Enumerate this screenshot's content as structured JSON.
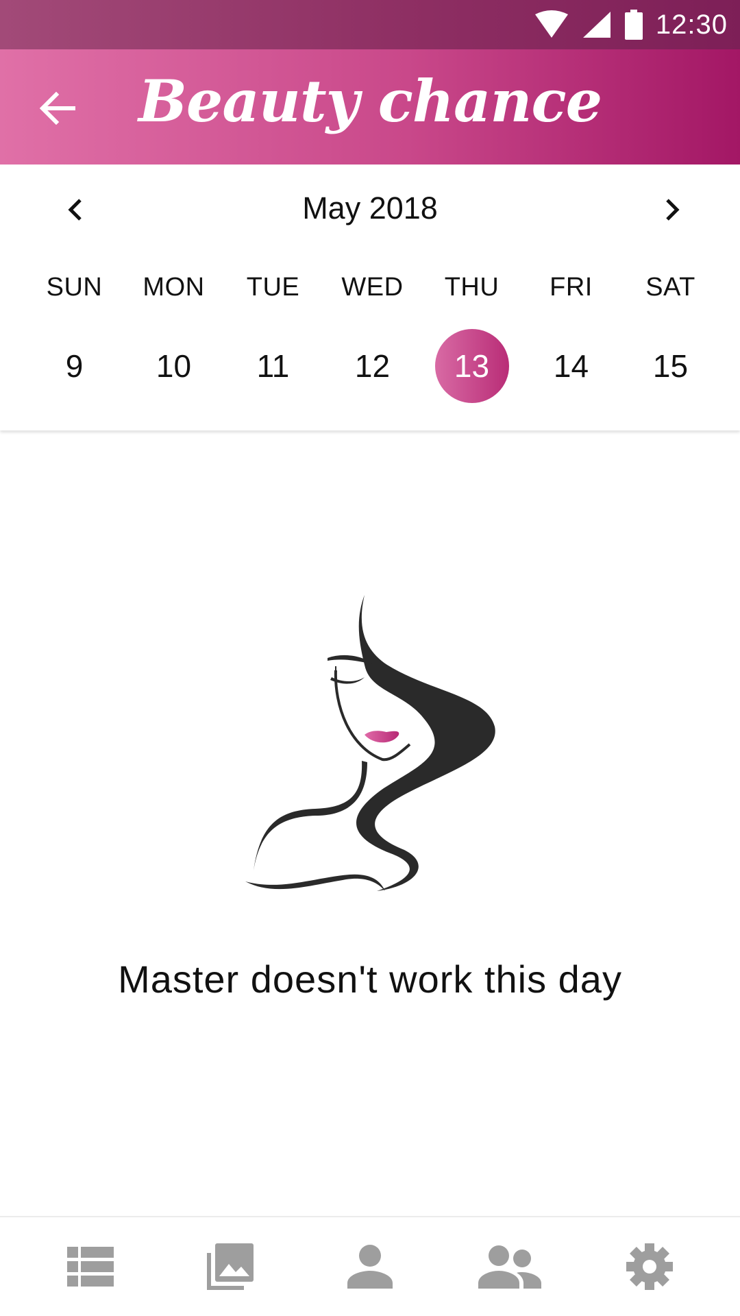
{
  "status_bar": {
    "time": "12:30",
    "icons": [
      "wifi-icon",
      "signal-icon",
      "battery-icon"
    ]
  },
  "app_bar": {
    "title": "Beauty chance",
    "back_icon": "arrow-back-icon"
  },
  "calendar": {
    "month_label": "May 2018",
    "prev_icon": "chevron-left-icon",
    "next_icon": "chevron-right-icon",
    "weekdays": [
      "SUN",
      "MON",
      "TUE",
      "WED",
      "THU",
      "FRI",
      "SAT"
    ],
    "days": [
      "9",
      "10",
      "11",
      "12",
      "13",
      "14",
      "15"
    ],
    "selected_day": "13"
  },
  "main": {
    "illustration": "woman-silhouette-icon",
    "message": "Master doesn't work this day"
  },
  "bottom_nav": {
    "items": [
      "list-icon",
      "gallery-icon",
      "person-icon",
      "group-icon",
      "settings-icon"
    ]
  },
  "colors": {
    "accent": "#c1357e",
    "app_bar_start": "#e070a7",
    "app_bar_end": "#a31765",
    "nav_icon": "#9e9e9e"
  }
}
